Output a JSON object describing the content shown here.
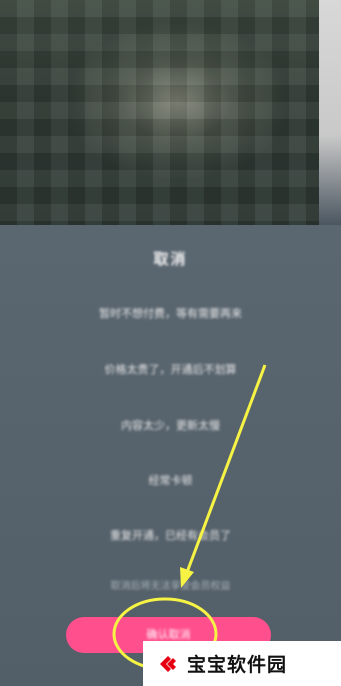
{
  "dialog": {
    "title": "取消",
    "reasons": [
      "暂时不想付费，等有需要再来",
      "价格太贵了，开通后不划算",
      "内容太少，更新太慢",
      "经常卡顿",
      "重复开通，已经有会员了"
    ],
    "hint": "取消后将无法享受会员权益",
    "confirm_label": "确认取消"
  },
  "watermark": {
    "brand": "宝宝软件园"
  },
  "colors": {
    "accent": "#ff4f8d",
    "panel": "#55626b",
    "annotation": "#f6f345"
  }
}
